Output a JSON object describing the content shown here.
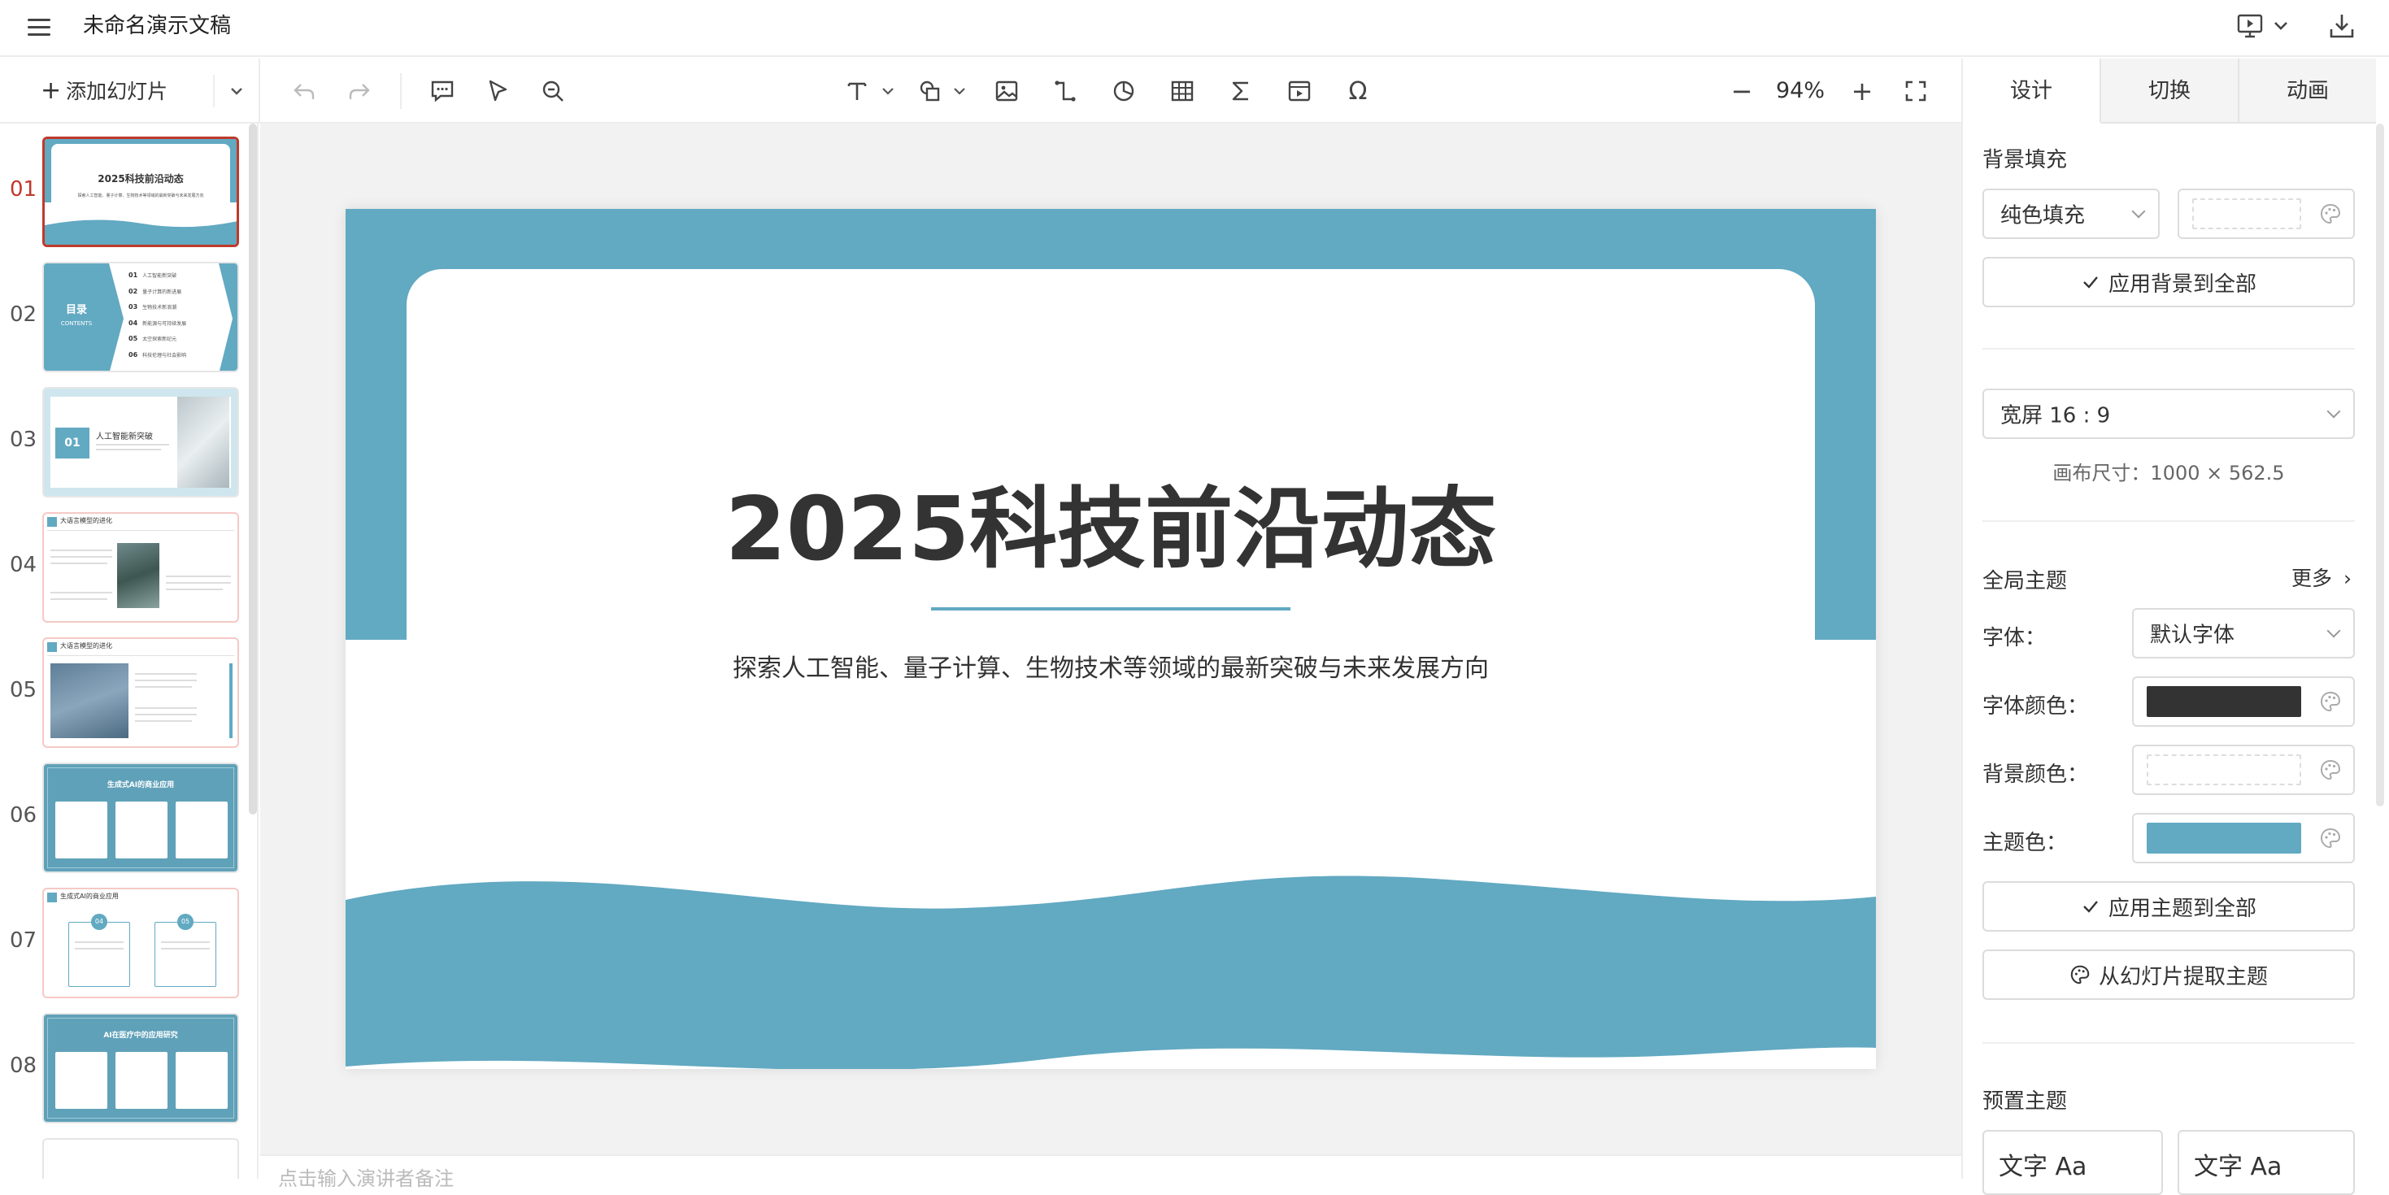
{
  "app": {
    "title": "未命名演示文稿"
  },
  "toolbar": {
    "add_slide_label": "添加幻灯片",
    "zoom": "94%"
  },
  "thumbnails": [
    {
      "num": "01",
      "active": true,
      "title": "2025科技前沿动态",
      "sub": "探索人工智能、量子计算、生物技术等领域的最新突破与未来发展方向"
    },
    {
      "num": "02",
      "title": "目录",
      "sub": "CONTENTS",
      "items": [
        {
          "n": "01",
          "t": "人工智能新突破"
        },
        {
          "n": "02",
          "t": "量子计算的新进展"
        },
        {
          "n": "03",
          "t": "生物技术新浪潮"
        },
        {
          "n": "04",
          "t": "新能源与可持续发展"
        },
        {
          "n": "05",
          "t": "太空探索新纪元"
        },
        {
          "n": "06",
          "t": "科技伦理与社会影响"
        }
      ]
    },
    {
      "num": "03",
      "badge": "01",
      "title": "人工智能新突破"
    },
    {
      "num": "04",
      "title": "大语言模型的进化"
    },
    {
      "num": "05",
      "title": "大语言模型的进化"
    },
    {
      "num": "06",
      "title": "生成式AI的商业应用"
    },
    {
      "num": "07",
      "title": "生成式AI的商业应用",
      "badges": [
        "04",
        "05"
      ]
    },
    {
      "num": "08",
      "title": "AI在医疗中的应用研究"
    }
  ],
  "slide": {
    "title": "2025科技前沿动态",
    "subtitle": "探索人工智能、量子计算、生物技术等领域的最新突破与未来发展方向",
    "theme_color": "#62a9c2"
  },
  "notes": {
    "placeholder": "点击输入演讲者备注"
  },
  "panel": {
    "tabs": [
      "设计",
      "切换",
      "动画"
    ],
    "bg_fill": {
      "label": "背景填充",
      "type": "纯色填充",
      "apply_all": "应用背景到全部"
    },
    "ratio": {
      "value": "宽屏 16 : 9",
      "canvas_size": "画布尺寸：1000 × 562.5"
    },
    "theme": {
      "label": "全局主题",
      "more": "更多",
      "font_label": "字体：",
      "font_value": "默认字体",
      "font_color_label": "字体颜色：",
      "font_color": "#333333",
      "bg_color_label": "背景颜色：",
      "theme_color_label": "主题色：",
      "theme_color": "#62a9c2",
      "apply_all": "应用主题到全部",
      "extract": "从幻灯片提取主题"
    },
    "presets": {
      "label": "预置主题",
      "cards": [
        "文字 Aa",
        "文字 Aa"
      ]
    }
  }
}
